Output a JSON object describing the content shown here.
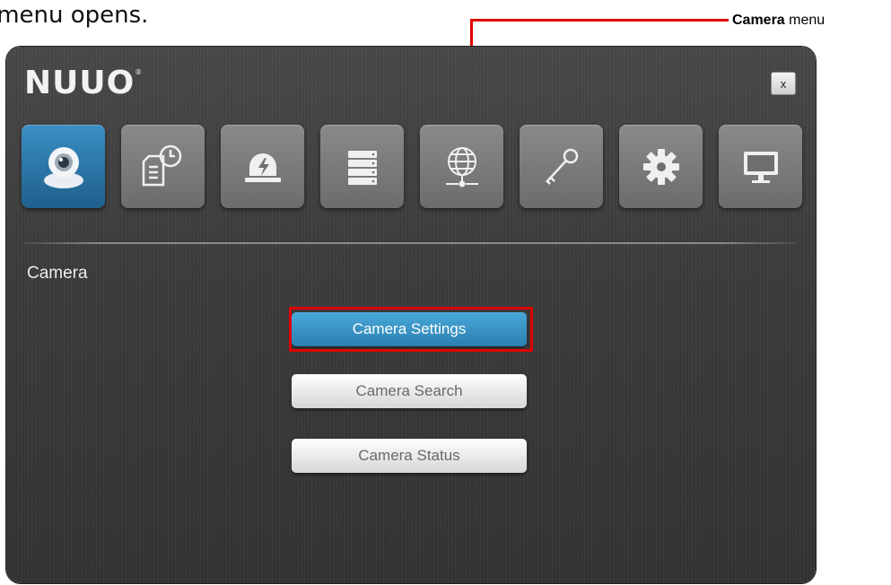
{
  "caption": "a menu opens.",
  "callout": {
    "bold": "Camera",
    "rest": " menu",
    "color": "#e00000"
  },
  "app": {
    "logo": "NUUO",
    "logo_mark": "®",
    "close_label": "x",
    "toolbar": [
      {
        "name": "camera",
        "icon": "webcam-icon",
        "active": true
      },
      {
        "name": "event-log",
        "icon": "clock-document-icon",
        "active": false
      },
      {
        "name": "alarm",
        "icon": "alarm-light-icon",
        "active": false
      },
      {
        "name": "storage",
        "icon": "server-stack-icon",
        "active": false
      },
      {
        "name": "network",
        "icon": "globe-network-icon",
        "active": false
      },
      {
        "name": "security",
        "icon": "key-icon",
        "active": false
      },
      {
        "name": "settings",
        "icon": "gear-icon",
        "active": false
      },
      {
        "name": "display",
        "icon": "monitor-icon",
        "active": false
      }
    ],
    "section_title": "Camera",
    "buttons": {
      "camera_settings": "Camera Settings",
      "camera_search": "Camera Search",
      "camera_status": "Camera Status"
    },
    "accent_color": "#2a7fb0"
  }
}
